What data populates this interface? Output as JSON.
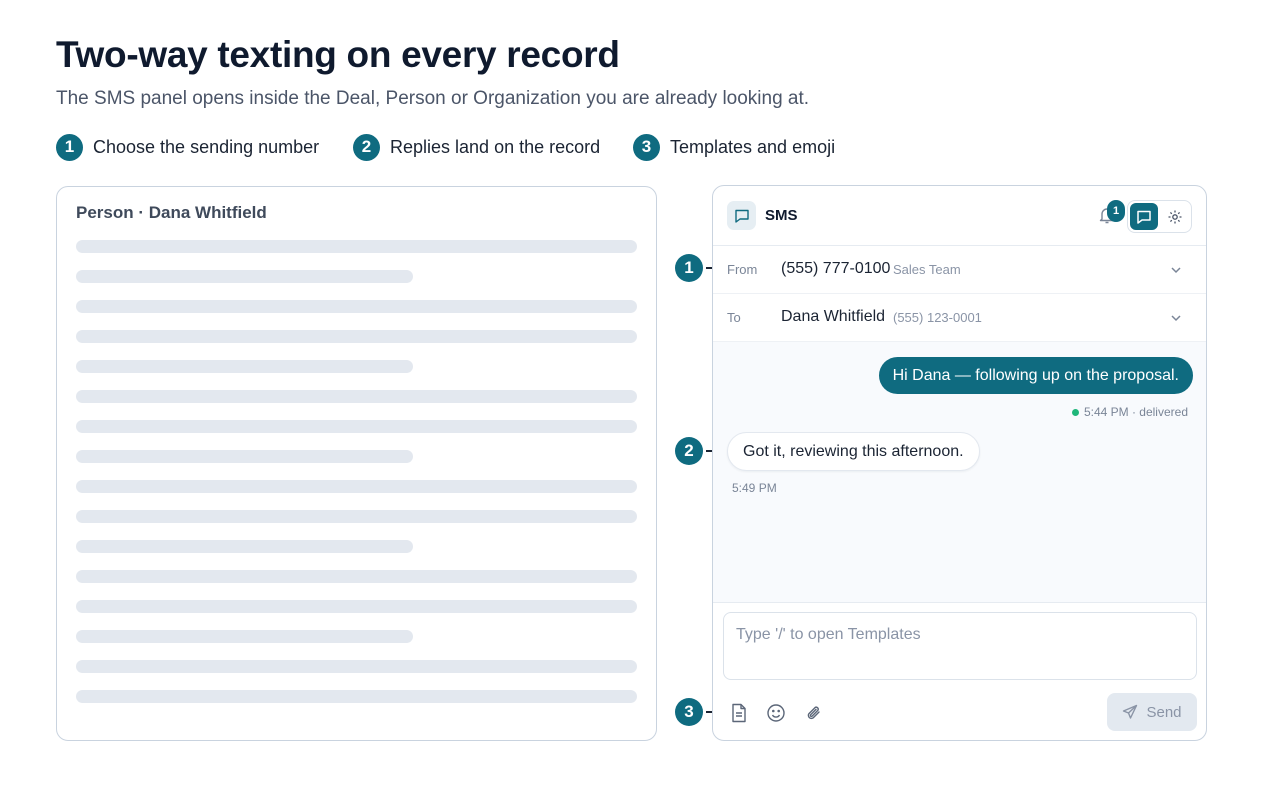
{
  "page": {
    "title": "Two-way texting on every record",
    "subtitle": "The SMS panel opens inside the Deal, Person or Organization you are already looking at."
  },
  "steps": [
    {
      "number": "1",
      "label": "Choose the sending number"
    },
    {
      "number": "2",
      "label": "Replies land on the record"
    },
    {
      "number": "3",
      "label": "Templates and emoji"
    }
  ],
  "record": {
    "title": "Person · Dana Whitfield"
  },
  "sms_panel": {
    "title": "SMS",
    "notification_count": "1",
    "from": {
      "label": "From",
      "value": "(555) 777-0100",
      "sub": "Sales Team"
    },
    "to": {
      "label": "To",
      "value": "Dana Whitfield",
      "sub": "(555) 123-0001"
    },
    "messages": {
      "outgoing": {
        "text": "Hi Dana — following up on the proposal.",
        "meta": "5:44 PM · delivered"
      },
      "incoming": {
        "text": "Got it, reviewing this afternoon.",
        "meta": "5:49 PM"
      }
    },
    "composer": {
      "placeholder": "Type '/' to open Templates",
      "send_label": "Send"
    }
  },
  "callouts": [
    "1",
    "2",
    "3"
  ],
  "colors": {
    "accent": "#0f6b80",
    "delivered": "#1fb67a"
  },
  "icons": [
    "chat-bubble-icon",
    "bell-icon",
    "gear-icon",
    "chevron-down-icon",
    "template-document-icon",
    "emoji-icon",
    "paperclip-icon",
    "send-icon"
  ]
}
